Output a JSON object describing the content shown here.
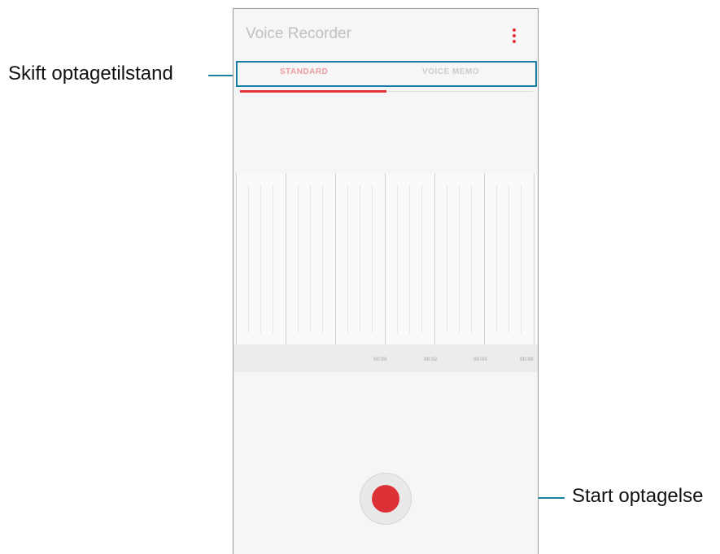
{
  "callouts": {
    "mode_switch": "Skift optagetilstand",
    "start_recording": "Start optagelse"
  },
  "app": {
    "title": "Voice Recorder",
    "more_icon": "more-vertical-icon",
    "accent_color": "#e2333a"
  },
  "tabs": [
    {
      "label": "STANDARD",
      "selected": true
    },
    {
      "label": "VOICE MEMO",
      "selected": false
    }
  ],
  "timeline": {
    "ticks": [
      "00:00",
      "00:02",
      "00:04",
      "00:06"
    ]
  },
  "record_button": {
    "icon": "record-dot-icon",
    "color": "#dc3237"
  },
  "highlight_color": "#1a7fa7"
}
